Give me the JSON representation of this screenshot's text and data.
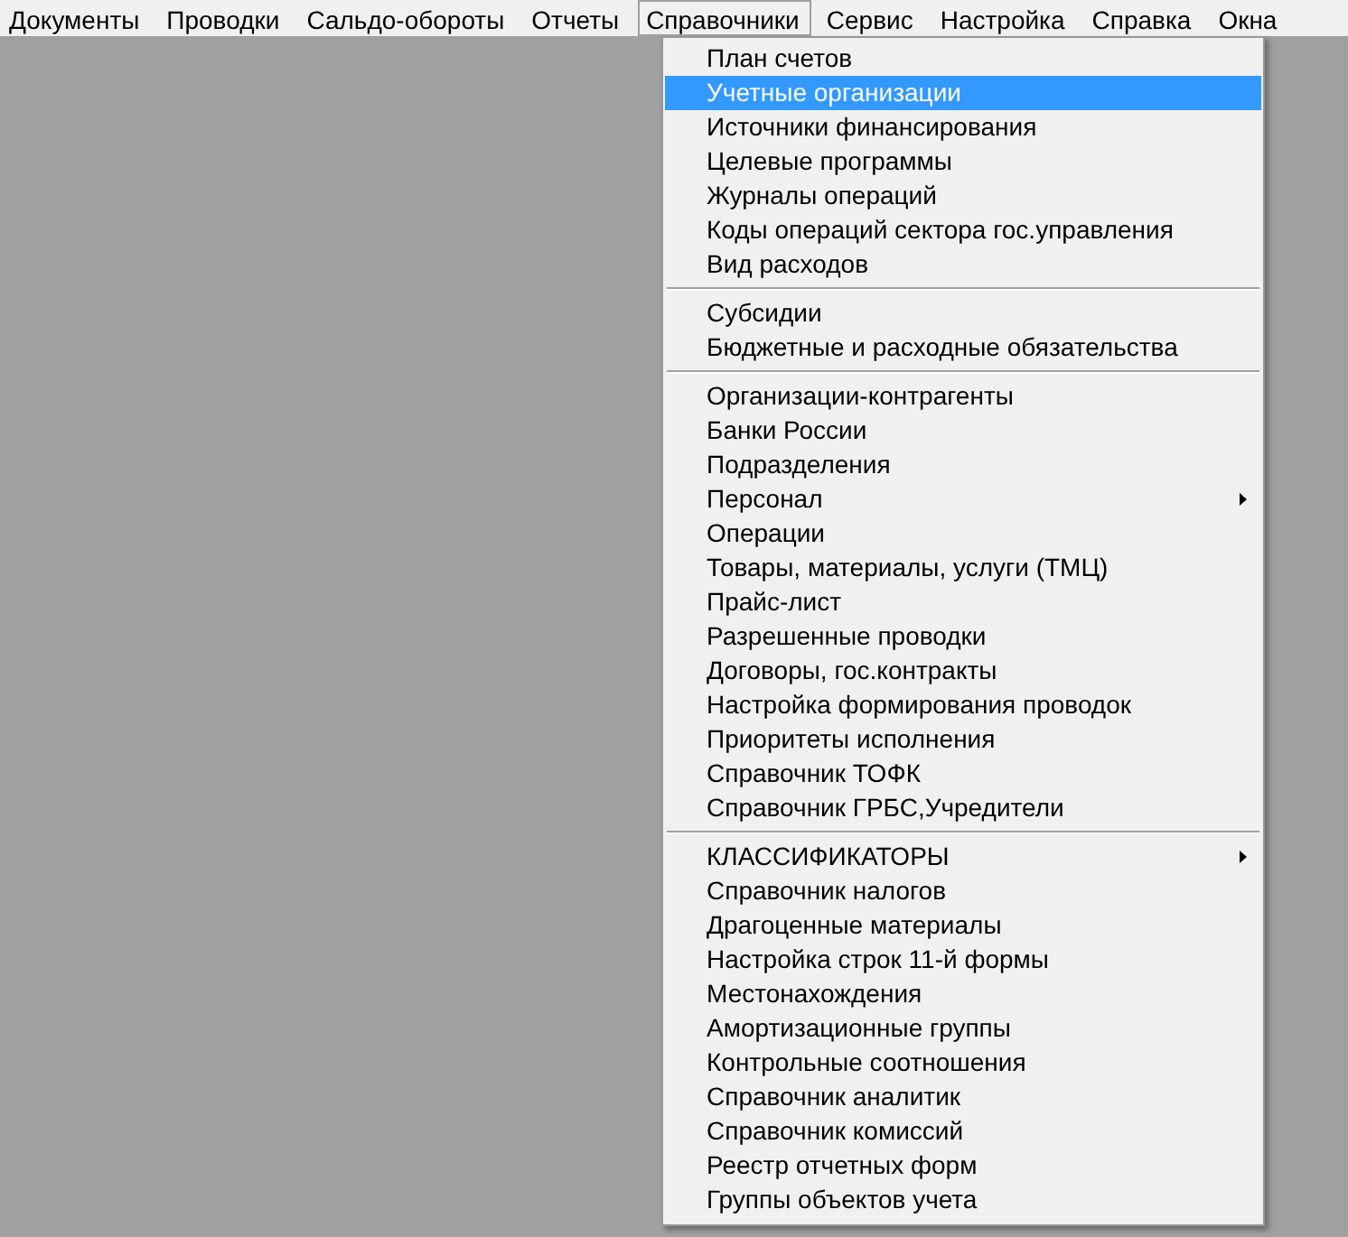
{
  "menu_bar": [
    {
      "label": "Документы",
      "selected": false
    },
    {
      "label": "Проводки",
      "selected": false
    },
    {
      "label": "Сальдо-обороты",
      "selected": false
    },
    {
      "label": "Отчеты",
      "selected": false
    },
    {
      "label": "Справочники",
      "selected": true
    },
    {
      "label": "Сервис",
      "selected": false
    },
    {
      "label": "Настройка",
      "selected": false
    },
    {
      "label": "Справка",
      "selected": false
    },
    {
      "label": "Окна",
      "selected": false
    }
  ],
  "dropdown": {
    "groups": [
      [
        {
          "label": "План счетов",
          "selected": false,
          "submenu": false
        },
        {
          "label": "Учетные организации",
          "selected": true,
          "submenu": false
        },
        {
          "label": "Источники финансирования",
          "selected": false,
          "submenu": false
        },
        {
          "label": "Целевые программы",
          "selected": false,
          "submenu": false
        },
        {
          "label": "Журналы операций",
          "selected": false,
          "submenu": false
        },
        {
          "label": "Коды операций сектора гос.управления",
          "selected": false,
          "submenu": false
        },
        {
          "label": "Вид расходов",
          "selected": false,
          "submenu": false
        }
      ],
      [
        {
          "label": "Субсидии",
          "selected": false,
          "submenu": false
        },
        {
          "label": "Бюджетные и расходные обязательства",
          "selected": false,
          "submenu": false
        }
      ],
      [
        {
          "label": "Организации-контрагенты",
          "selected": false,
          "submenu": false
        },
        {
          "label": "Банки России",
          "selected": false,
          "submenu": false
        },
        {
          "label": "Подразделения",
          "selected": false,
          "submenu": false
        },
        {
          "label": "Персонал",
          "selected": false,
          "submenu": true
        },
        {
          "label": "Операции",
          "selected": false,
          "submenu": false
        },
        {
          "label": "Товары, материалы, услуги (ТМЦ)",
          "selected": false,
          "submenu": false
        },
        {
          "label": "Прайс-лист",
          "selected": false,
          "submenu": false
        },
        {
          "label": "Разрешенные проводки",
          "selected": false,
          "submenu": false
        },
        {
          "label": "Договоры, гос.контракты",
          "selected": false,
          "submenu": false
        },
        {
          "label": "Настройка формирования проводок",
          "selected": false,
          "submenu": false
        },
        {
          "label": "Приоритеты исполнения",
          "selected": false,
          "submenu": false
        },
        {
          "label": "Справочник ТОФК",
          "selected": false,
          "submenu": false
        },
        {
          "label": "Справочник ГРБС,Учредители",
          "selected": false,
          "submenu": false
        }
      ],
      [
        {
          "label": "КЛАССИФИКАТОРЫ",
          "selected": false,
          "submenu": true
        },
        {
          "label": "Справочник налогов",
          "selected": false,
          "submenu": false
        },
        {
          "label": "Драгоценные материалы",
          "selected": false,
          "submenu": false
        },
        {
          "label": "Настройка строк 11-й формы",
          "selected": false,
          "submenu": false
        },
        {
          "label": "Местонахождения",
          "selected": false,
          "submenu": false
        },
        {
          "label": "Амортизационные группы",
          "selected": false,
          "submenu": false
        },
        {
          "label": "Контрольные соотношения",
          "selected": false,
          "submenu": false
        },
        {
          "label": "Справочник аналитик",
          "selected": false,
          "submenu": false
        },
        {
          "label": "Справочник комиссий",
          "selected": false,
          "submenu": false
        },
        {
          "label": "Реестр отчетных форм",
          "selected": false,
          "submenu": false
        },
        {
          "label": "Группы объектов учета",
          "selected": false,
          "submenu": false
        }
      ]
    ]
  }
}
